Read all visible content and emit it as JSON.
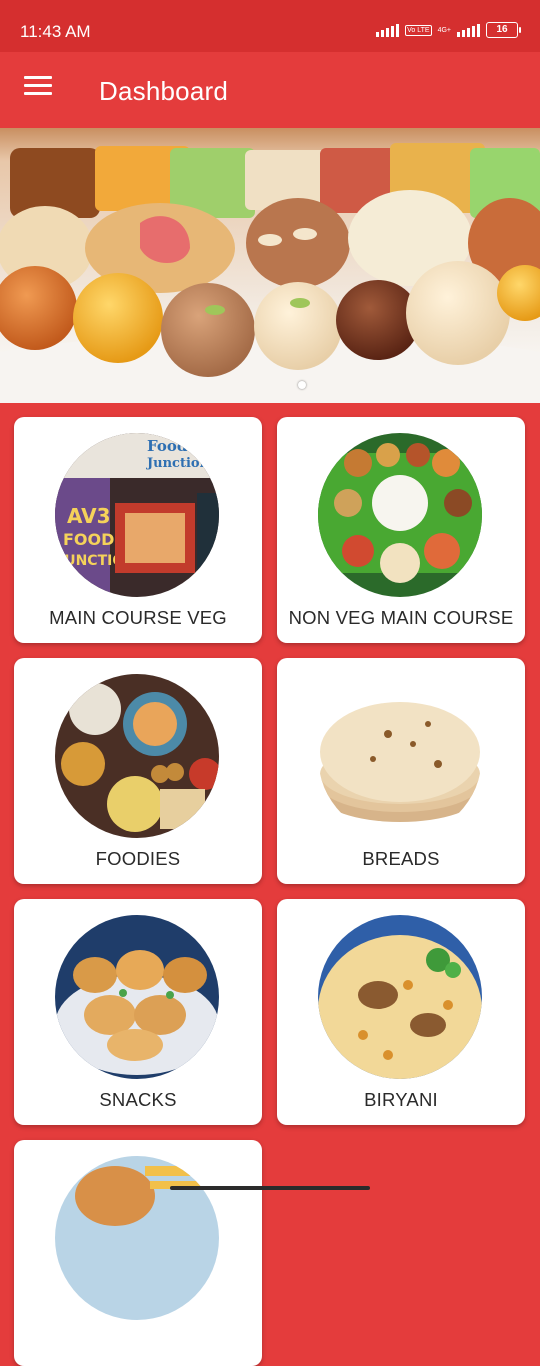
{
  "status": {
    "time": "11:43 AM",
    "lte_badge": "Vo LTE",
    "network": "4G+",
    "battery": "16"
  },
  "appbar": {
    "title": "Dashboard",
    "menu_icon": "hamburger-menu-icon"
  },
  "banner": {
    "alt": "Assorted Indian sweets platter",
    "pages": 1,
    "active_page": 1
  },
  "categories": [
    {
      "label": "MAIN COURSE VEG",
      "image": "food-junction-restaurant"
    },
    {
      "label": "NON VEG MAIN COURSE",
      "image": "thali-on-banana-leaf"
    },
    {
      "label": "FOODIES",
      "image": "assorted-dishes-table"
    },
    {
      "label": "BREADS",
      "image": "stack-of-chapati"
    },
    {
      "label": "SNACKS",
      "image": "fried-snacks-bowl"
    },
    {
      "label": "BIRYANI",
      "image": "biryani-plate"
    },
    {
      "label": "",
      "image": "partial-card"
    }
  ],
  "colors": {
    "primary": "#e43c3c",
    "status_bar": "#d52f2f",
    "card": "#ffffff",
    "text": "#2a2a2a"
  }
}
